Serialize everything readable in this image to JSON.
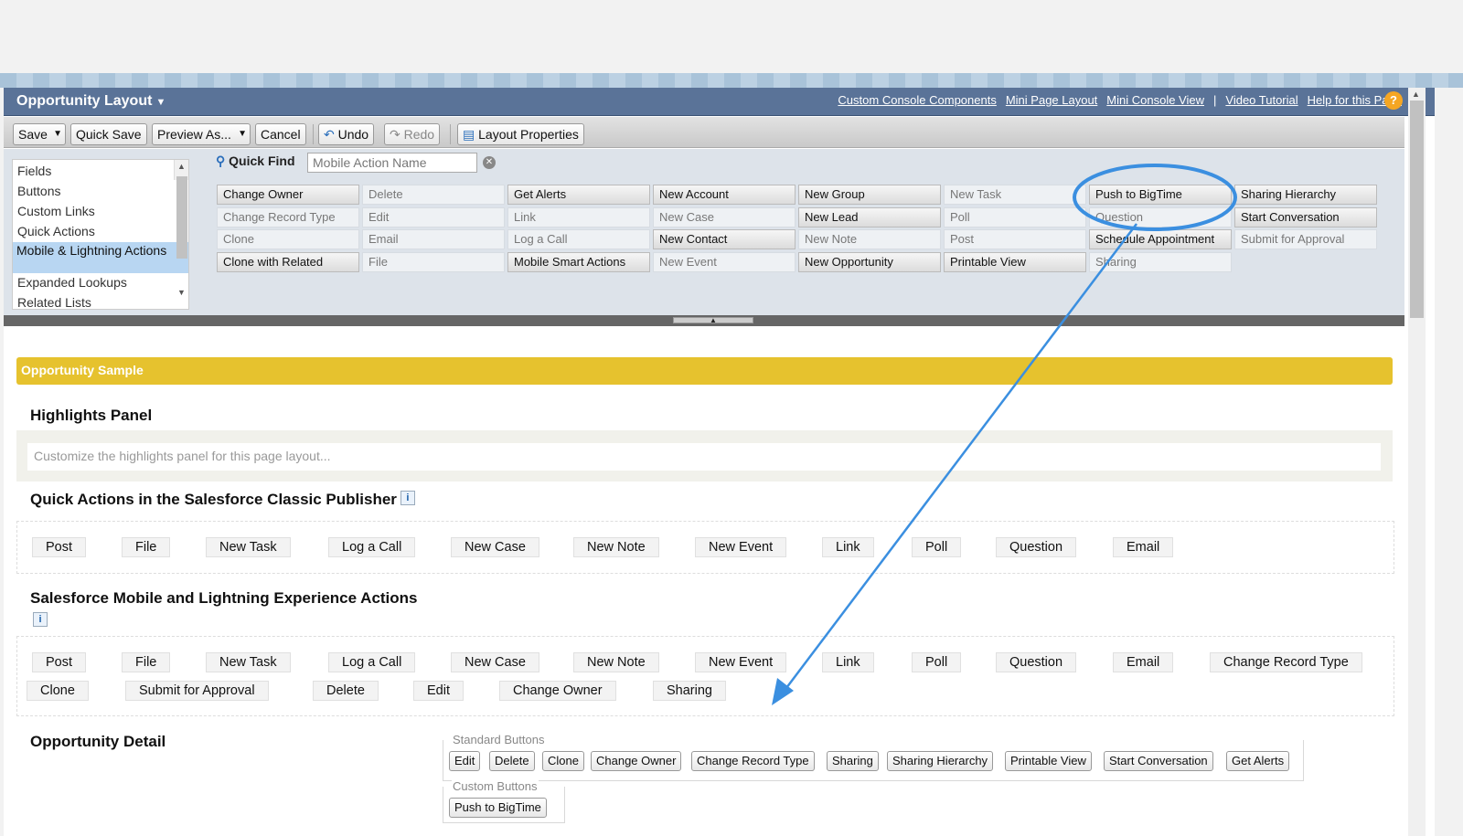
{
  "header": {
    "title": "Opportunity Layout",
    "links": [
      "Custom Console Components",
      "Mini Page Layout",
      "Mini Console View",
      "Video Tutorial",
      "Help for this Page"
    ],
    "separator": "|",
    "help_label": "?"
  },
  "toolbar": {
    "save": "Save",
    "quick_save": "Quick Save",
    "preview_as": "Preview As...",
    "cancel": "Cancel",
    "undo": "Undo",
    "redo": "Redo",
    "layout_properties": "Layout Properties"
  },
  "categories": [
    "Fields",
    "Buttons",
    "Custom Links",
    "Quick Actions",
    "Mobile & Lightning Actions",
    "Expanded Lookups",
    "Related Lists"
  ],
  "selected_category": "Mobile & Lightning Actions",
  "quick_find": {
    "label": "Quick Find",
    "placeholder": "Mobile Action Name"
  },
  "palette_items": [
    [
      "Change Owner",
      "Delete",
      "Get Alerts",
      "New Account",
      "New Group",
      "New Task",
      "Push to BigTime",
      "Sharing Hierarchy"
    ],
    [
      "Change Record Type",
      "Edit",
      "Link",
      "New Case",
      "New Lead",
      "Poll",
      "Question",
      "Start Conversation"
    ],
    [
      "Clone",
      "Email",
      "Log a Call",
      "New Contact",
      "New Note",
      "Post",
      "Schedule Appointment",
      "Submit for Approval"
    ],
    [
      "Clone with Related",
      "File",
      "Mobile Smart Actions",
      "New Event",
      "New Opportunity",
      "Printable View",
      "Sharing",
      ""
    ]
  ],
  "palette_enabled": [
    [
      true,
      false,
      true,
      true,
      true,
      false,
      true,
      true
    ],
    [
      false,
      false,
      false,
      false,
      true,
      false,
      false,
      true
    ],
    [
      false,
      false,
      false,
      true,
      false,
      false,
      true,
      false
    ],
    [
      true,
      false,
      true,
      false,
      true,
      true,
      false,
      false
    ]
  ],
  "canvas": {
    "sample_title": "Opportunity Sample",
    "highlights_title": "Highlights Panel",
    "highlights_placeholder": "Customize the highlights panel for this page layout...",
    "classic_title": "Quick Actions in the Salesforce Classic Publisher",
    "classic_actions": [
      "Post",
      "File",
      "New Task",
      "Log a Call",
      "New Case",
      "New Note",
      "New Event",
      "Link",
      "Poll",
      "Question",
      "Email"
    ],
    "mobile_title": "Salesforce Mobile and Lightning Experience Actions",
    "mobile_actions_row1": [
      "Post",
      "File",
      "New Task",
      "Log a Call",
      "New Case",
      "New Note",
      "New Event",
      "Link",
      "Poll",
      "Question",
      "Email",
      "Change Record Type"
    ],
    "mobile_actions_row2": [
      "Clone",
      "Submit for Approval",
      "Delete",
      "Edit",
      "Change Owner",
      "Sharing"
    ],
    "detail_title": "Opportunity Detail",
    "standard_buttons_label": "Standard Buttons",
    "standard_buttons": [
      "Edit",
      "Delete",
      "Clone",
      "Change Owner",
      "Change Record Type",
      "Sharing",
      "Sharing Hierarchy",
      "Printable View",
      "Start Conversation",
      "Get Alerts"
    ],
    "custom_buttons_label": "Custom Buttons",
    "custom_buttons": [
      "Push to BigTime"
    ],
    "info_label": "i"
  },
  "annotation": {
    "color": "#3b8fe0"
  }
}
